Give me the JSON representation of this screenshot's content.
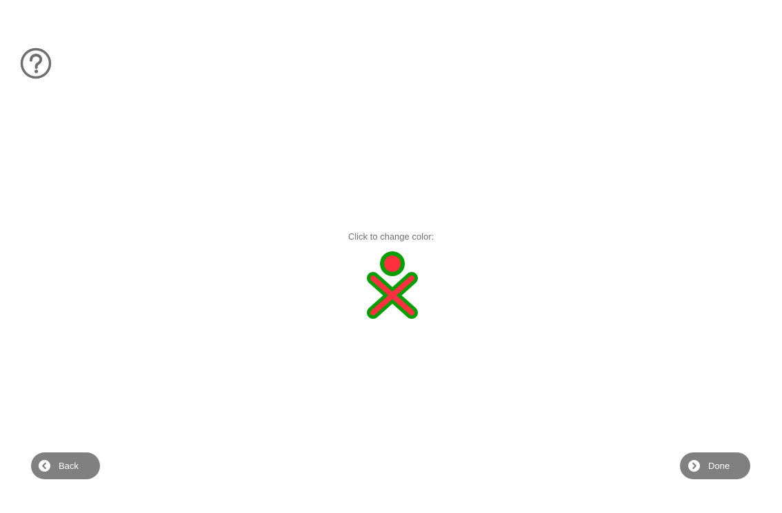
{
  "help": {
    "icon": "help-icon"
  },
  "prompt": {
    "text": "Click to change color:"
  },
  "xo_icon": {
    "icon": "xo-buddy-icon",
    "stroke_color": "#00A000",
    "fill_color": "#FF3040"
  },
  "navigation": {
    "back_label": "Back",
    "back_icon": "chevron-left-icon",
    "done_label": "Done",
    "done_icon": "chevron-right-icon"
  },
  "colors": {
    "background": "#FFFFFF",
    "button_bg": "#808080",
    "button_text": "#FFFFFF",
    "prompt_text": "#6F6F6F",
    "help_icon": "#6F6F6F"
  }
}
